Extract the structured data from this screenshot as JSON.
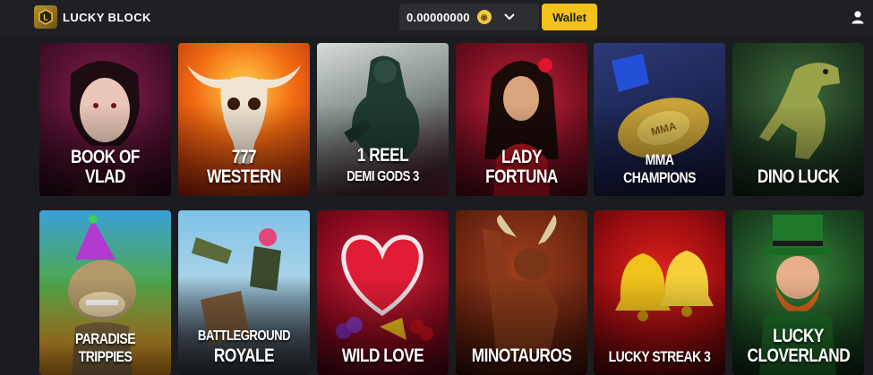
{
  "header": {
    "brand": "LUCKY BLOCK",
    "balance": "0.00000000",
    "wallet_label": "Wallet",
    "icons": {
      "logo": "lucky-block-logo",
      "coin": "coin-icon",
      "chevron": "chevron-down-icon",
      "user": "user-icon"
    },
    "colors": {
      "accent": "#f3c11b",
      "topbar": "#1f2023",
      "background": "#1b1c1f"
    }
  },
  "games": [
    {
      "title": "BOOK OF VLAD"
    },
    {
      "title": "777 WESTERN"
    },
    {
      "title": "1 REEL",
      "subtitle": "DEMI GODS 3"
    },
    {
      "title": "LADY",
      "subtitle": "FORTUNA"
    },
    {
      "title": "MMA CHAMPIONS"
    },
    {
      "title": "DINO LUCK"
    },
    {
      "title": "PARADISE TRIPPIES"
    },
    {
      "title": "BATTLEGROUND",
      "subtitle": "ROYALE"
    },
    {
      "title": "WILD LOVE"
    },
    {
      "title": "MINOTAUROS"
    },
    {
      "title": "LUCKY STREAK 3"
    },
    {
      "title": "LUCKY",
      "subtitle": "CLOVERLAND"
    }
  ]
}
